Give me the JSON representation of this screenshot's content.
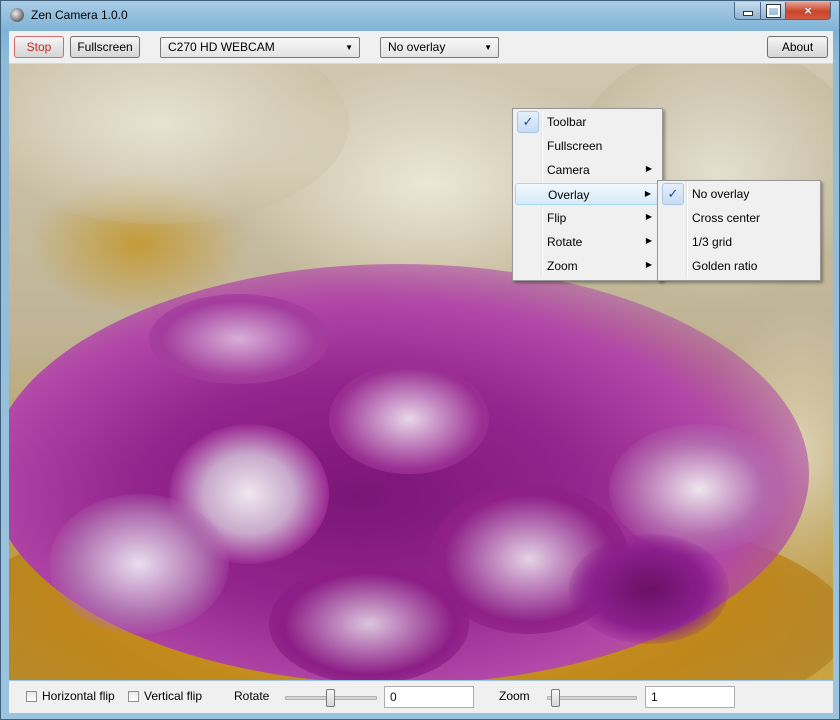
{
  "window": {
    "title": "Zen Camera 1.0.0",
    "controls": {
      "minimize": "minimize",
      "maximize": "maximize",
      "close": "×"
    }
  },
  "toolbar": {
    "stop_label": "Stop",
    "fullscreen_label": "Fullscreen",
    "camera_select": "C270 HD WEBCAM",
    "overlay_select": "No overlay",
    "about_label": "About",
    "dropdown_arrow": "▼"
  },
  "context_menu": {
    "items": [
      {
        "label": "Toolbar",
        "checked": true
      },
      {
        "label": "Fullscreen"
      },
      {
        "label": "Camera",
        "submenu": true
      },
      {
        "label": "Overlay",
        "submenu": true,
        "highlighted": true
      },
      {
        "label": "Flip",
        "submenu": true
      },
      {
        "label": "Rotate",
        "submenu": true
      },
      {
        "label": "Zoom",
        "submenu": true
      }
    ],
    "submenu_arrow": "▶",
    "check_mark": "✓"
  },
  "overlay_submenu": {
    "items": [
      {
        "label": "No overlay",
        "checked": true
      },
      {
        "label": "Cross center"
      },
      {
        "label": "1/3 grid"
      },
      {
        "label": "Golden ratio"
      }
    ]
  },
  "bottom": {
    "horizontal_flip_label": "Horizontal flip",
    "vertical_flip_label": "Vertical flip",
    "rotate_label": "Rotate",
    "rotate_value": "0",
    "zoom_label": "Zoom",
    "zoom_value": "1"
  },
  "colors": {
    "stop_text": "#d1251b",
    "menu_highlight": "#d5ebf8",
    "flower_purple": "#8a1f8c"
  }
}
